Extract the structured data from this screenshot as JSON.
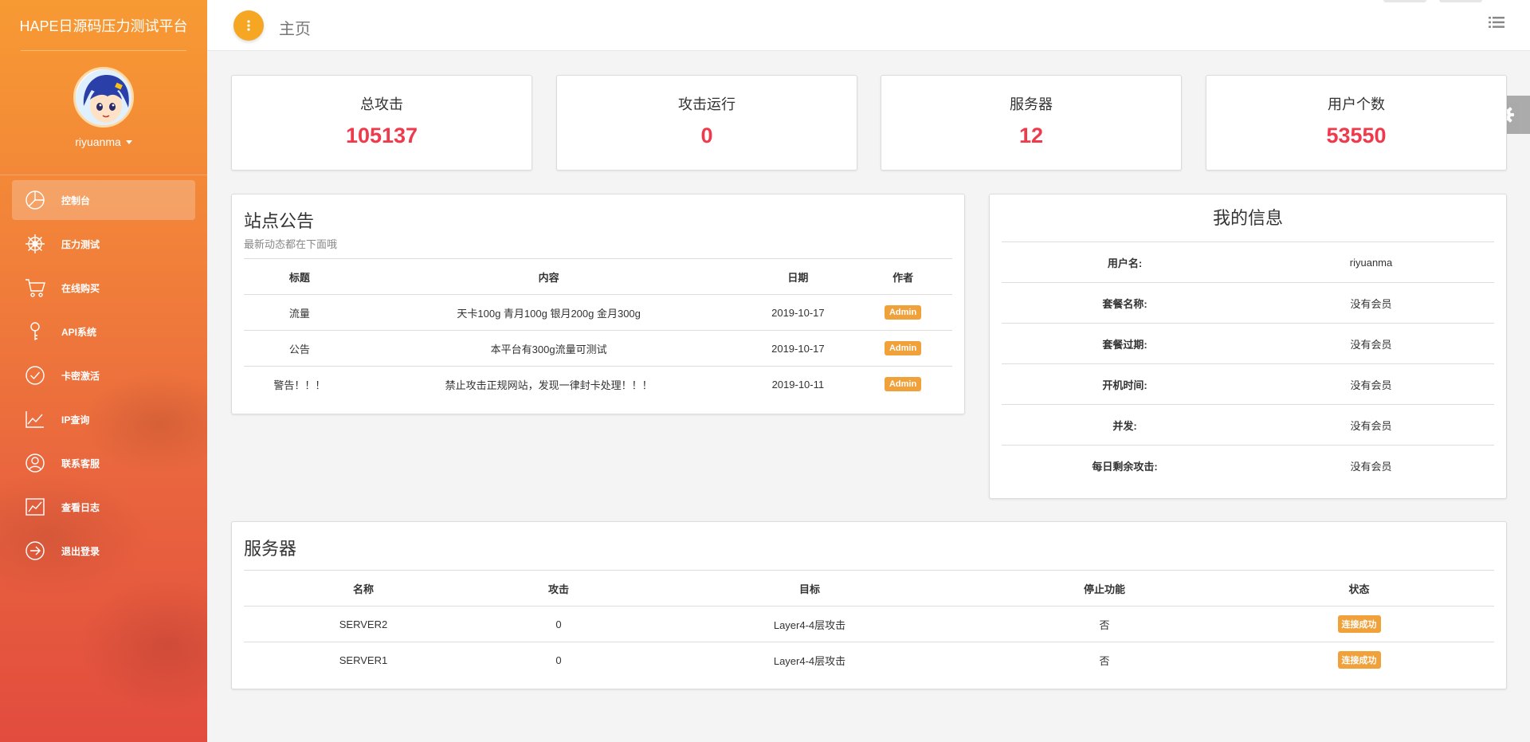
{
  "brand": "HAPE日源码压力测试平台",
  "user": {
    "name": "riyuanma"
  },
  "nav": [
    {
      "label": "控制台",
      "icon": "pie-chart-icon"
    },
    {
      "label": "压力测试",
      "icon": "ship-wheel-icon"
    },
    {
      "label": "在线购买",
      "icon": "cart-icon"
    },
    {
      "label": "API系统",
      "icon": "key-icon"
    },
    {
      "label": "卡密激活",
      "icon": "check-circle-icon"
    },
    {
      "label": "IP查询",
      "icon": "line-chart-icon"
    },
    {
      "label": "联系客服",
      "icon": "user-circle-icon"
    },
    {
      "label": "查看日志",
      "icon": "chart-log-icon"
    },
    {
      "label": "退出登录",
      "icon": "logout-arrow-icon"
    }
  ],
  "header": {
    "title": "主页"
  },
  "stats": [
    {
      "label": "总攻击",
      "value": "105137"
    },
    {
      "label": "攻击运行",
      "value": "0"
    },
    {
      "label": "服务器",
      "value": "12"
    },
    {
      "label": "用户个数",
      "value": "53550"
    }
  ],
  "notice": {
    "title": "站点公告",
    "subtitle": "最新动态都在下面哦",
    "columns": [
      "标题",
      "内容",
      "日期",
      "作者"
    ],
    "rows": [
      {
        "title": "流量",
        "content": "天卡100g 青月100g 银月200g 金月300g",
        "date": "2019-10-17",
        "author": "Admin"
      },
      {
        "title": "公告",
        "content": "本平台有300g流量可测试",
        "date": "2019-10-17",
        "author": "Admin"
      },
      {
        "title": "警告！！！",
        "content": "禁止攻击正规网站，发现一律封卡处理！！！",
        "date": "2019-10-11",
        "author": "Admin"
      }
    ]
  },
  "myinfo": {
    "title": "我的信息",
    "rows": [
      {
        "label": "用户名:",
        "value": "riyuanma"
      },
      {
        "label": "套餐名称:",
        "value": "没有会员"
      },
      {
        "label": "套餐过期:",
        "value": "没有会员"
      },
      {
        "label": "开机时间:",
        "value": "没有会员"
      },
      {
        "label": "并发:",
        "value": "没有会员"
      },
      {
        "label": "每日剩余攻击:",
        "value": "没有会员"
      }
    ]
  },
  "servers": {
    "title": "服务器",
    "columns": [
      "名称",
      "攻击",
      "目标",
      "停止功能",
      "状态"
    ],
    "rows": [
      {
        "name": "SERVER2",
        "attack": "0",
        "target": "Layer4-4层攻击",
        "stop": "否",
        "status": "连接成功"
      },
      {
        "name": "SERVER1",
        "attack": "0",
        "target": "Layer4-4层攻击",
        "stop": "否",
        "status": "连接成功"
      }
    ]
  },
  "colors": {
    "accent": "#f5a623",
    "value_red": "#f1394c",
    "badge": "#f0a13a"
  }
}
